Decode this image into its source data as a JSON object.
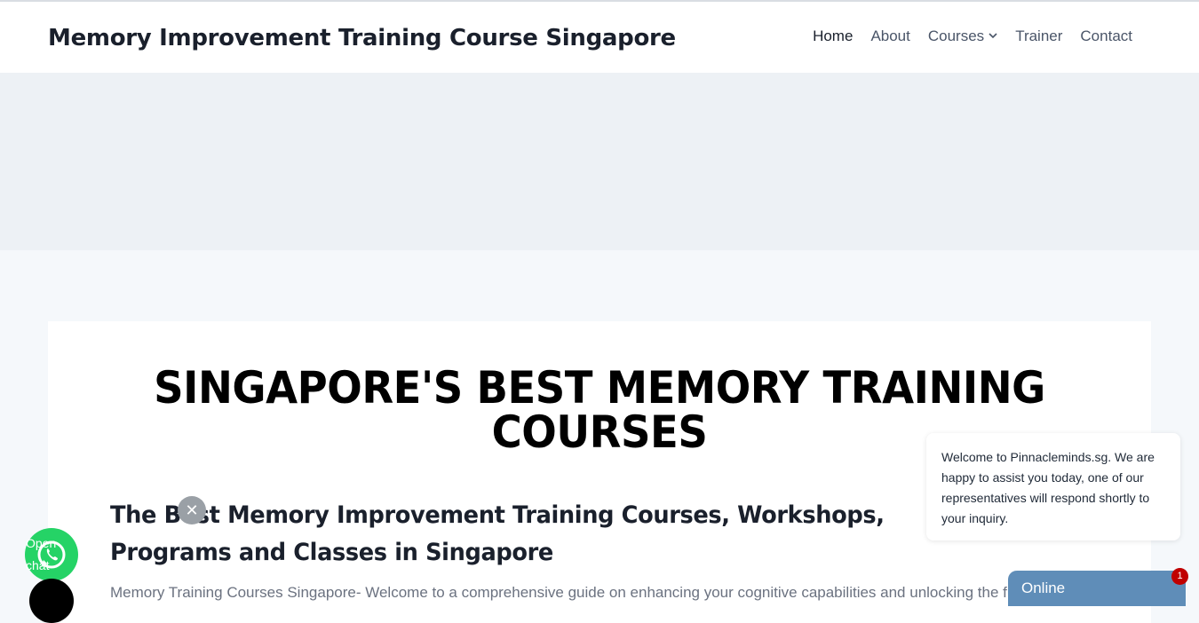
{
  "header": {
    "site_title": "Memory Improvement Training Course Singapore",
    "nav": [
      {
        "label": "Home",
        "active": true
      },
      {
        "label": "About"
      },
      {
        "label": "Courses",
        "has_dropdown": true
      },
      {
        "label": "Trainer"
      },
      {
        "label": "Contact"
      }
    ]
  },
  "main": {
    "heading": "SINGAPORE'S BEST MEMORY TRAINING COURSES",
    "subheading": "The Best Memory Improvement Training Courses, Workshops, Programs and Classes in Singapore",
    "intro": "Memory Training Courses Singapore- Welcome to a comprehensive guide on enhancing your cognitive capabilities and unlocking the full potential of your memory."
  },
  "chat": {
    "welcome_message": "Welcome to Pinnacleminds.sg. We are happy to assist you today, one of our representatives will respond shortly to your inquiry.",
    "status_label": "Online",
    "unread_count": "1"
  },
  "whatsapp": {
    "label": "Open chat",
    "close_symbol": "✕"
  },
  "colors": {
    "accent": "#5f8db8",
    "whatsapp": "#25d366",
    "badge": "#c00000"
  }
}
